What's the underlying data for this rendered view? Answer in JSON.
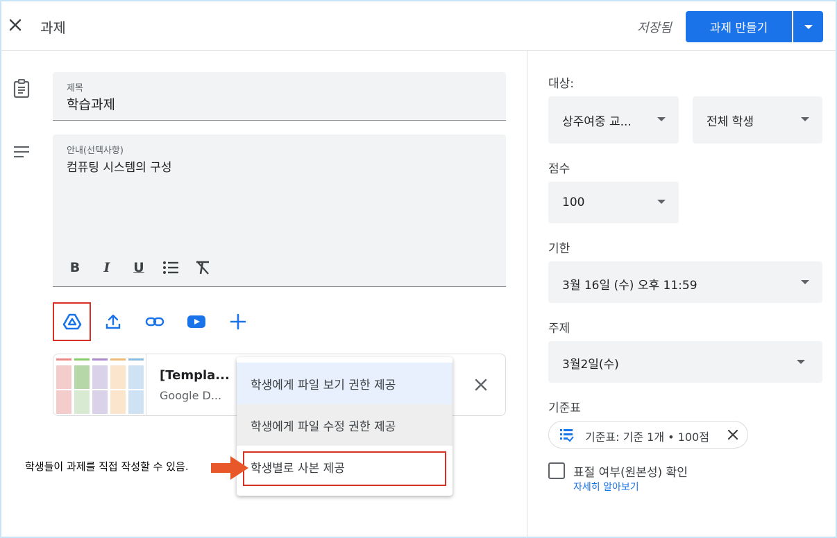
{
  "header": {
    "title": "과제",
    "saved_status": "저장됨",
    "create_button": "과제 만들기"
  },
  "form": {
    "title_label": "제목",
    "title_value": "학습과제",
    "desc_label": "안내(선택사항)",
    "desc_value": "컴퓨팅 시스템의 구성",
    "format_buttons": [
      "B",
      "I",
      "U",
      "list",
      "clear-format"
    ]
  },
  "attachment": {
    "name": "[Templa...",
    "type": "Google D..."
  },
  "share_menu": {
    "items": [
      "학생에게 파일 보기 권한 제공",
      "학생에게 파일 수정 권한 제공",
      "학생별로 사본 제공"
    ]
  },
  "annotation": {
    "note": "학생들이 과제를 직접 작성할 수 있음.",
    "highlight_color": "#d93025",
    "arrow_color": "#e8572a"
  },
  "sidebar": {
    "for_label": "대상:",
    "class_value": "상주여중 교...",
    "students_value": "전체 학생",
    "points_label": "점수",
    "points_value": "100",
    "due_label": "기한",
    "due_value": "3월 16일 (수) 오후 11:59",
    "topic_label": "주제",
    "topic_value": "3월2일(수)",
    "rubric_label": "기준표",
    "rubric_chip": "기준표: 기준 1개 • 100점",
    "originality_label": "표절 여부(원본성) 확인",
    "learn_more": "자세히 알아보기"
  },
  "colors": {
    "accent": "#1a73e8",
    "field_bg": "#f1f3f4"
  }
}
